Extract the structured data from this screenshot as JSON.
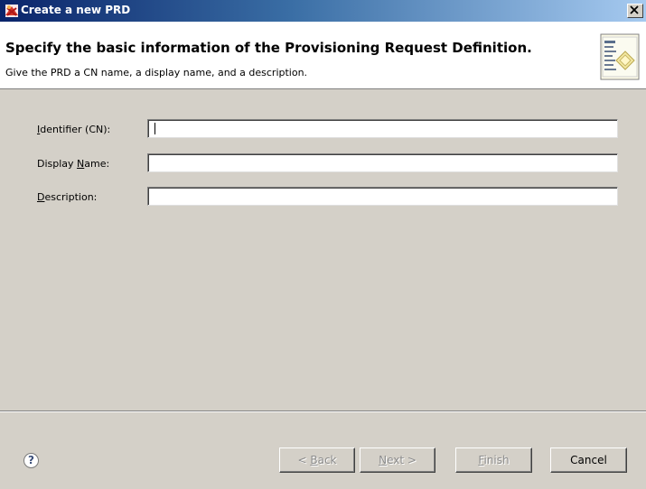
{
  "window": {
    "title": "Create a new PRD",
    "close_glyph": "×"
  },
  "header": {
    "title": "Specify the basic information of the Provisioning Request Definition.",
    "description": "Give the PRD a CN name, a display name, and a description."
  },
  "form": {
    "fields": [
      {
        "label": "Identifier (CN):",
        "mnemonic": "I",
        "rest": "dentifier (CN):",
        "value": ""
      },
      {
        "label": "Display Name:",
        "pre": "Display ",
        "mnemonic": "N",
        "rest": "ame:",
        "value": ""
      },
      {
        "label": "Description:",
        "mnemonic": "D",
        "rest": "escription:",
        "value": ""
      }
    ]
  },
  "footer": {
    "help_glyph": "?",
    "buttons": {
      "back": {
        "pre": "< ",
        "mnemonic": "B",
        "rest": "ack",
        "enabled": false
      },
      "next": {
        "mnemonic": "N",
        "rest": "ext >",
        "enabled": false
      },
      "finish": {
        "mnemonic": "F",
        "rest": "inish",
        "enabled": false
      },
      "cancel": {
        "label": "Cancel",
        "enabled": true
      }
    }
  },
  "colors": {
    "title_bar_start": "#0a246a",
    "title_bar_end": "#a6caf0",
    "dialog_background": "#d4d0c8",
    "disabled_text": "#8c8c8c"
  },
  "icons": {
    "title": "prd-wizard-icon",
    "header": "prd-document-icon",
    "help": "help-icon",
    "close": "close-icon"
  }
}
